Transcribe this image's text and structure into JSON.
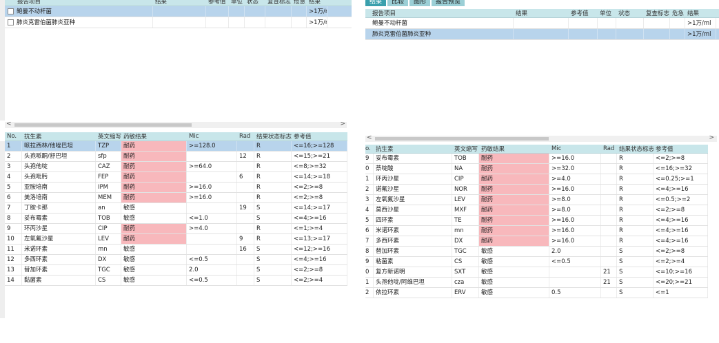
{
  "left": {
    "top_header": [
      "报告项目",
      "结果",
      "参考值",
      "单位",
      "状态",
      "复查标志",
      "危急",
      "结果"
    ],
    "top_rows": [
      {
        "name": "鲍曼不动杆菌",
        "result": ">1万/ml",
        "selected": true
      },
      {
        "name": "肺炎克雷伯菌肺炎亚种",
        "result": ">1万/ml",
        "selected": false
      }
    ],
    "scroll_left": "<",
    "scroll_right": ">",
    "bottom_header": [
      "No.",
      "抗生素",
      "英文缩写",
      "药敏结果",
      "Mic",
      "Rad",
      "结果状态标志",
      "参考值"
    ],
    "bottom_rows": [
      {
        "no": "1",
        "name": "哌拉西林/他唑巴坦",
        "abbr": "TZP",
        "res": "耐药",
        "mic": ">=128.0",
        "rad": "",
        "flag": "R",
        "ref": "<=16;>=128",
        "red": true,
        "sel": true
      },
      {
        "no": "2",
        "name": "头孢哌酮/舒巴坦",
        "abbr": "sfp",
        "res": "耐药",
        "mic": "",
        "rad": "12",
        "flag": "R",
        "ref": "<=15;>=21",
        "red": true
      },
      {
        "no": "3",
        "name": "头孢他啶",
        "abbr": "CAZ",
        "res": "耐药",
        "mic": ">=64.0",
        "rad": "",
        "flag": "R",
        "ref": "<=8;>=32",
        "red": true
      },
      {
        "no": "4",
        "name": "头孢吡肟",
        "abbr": "FEP",
        "res": "耐药",
        "mic": "",
        "rad": "6",
        "flag": "R",
        "ref": "<=14;>=18",
        "red": true
      },
      {
        "no": "5",
        "name": "亚胺培南",
        "abbr": "IPM",
        "res": "耐药",
        "mic": ">=16.0",
        "rad": "",
        "flag": "R",
        "ref": "<=2;>=8",
        "red": true
      },
      {
        "no": "6",
        "name": "美洛培南",
        "abbr": "MEM",
        "res": "耐药",
        "mic": ">=16.0",
        "rad": "",
        "flag": "R",
        "ref": "<=2;>=8",
        "red": true
      },
      {
        "no": "7",
        "name": "丁胺卡那",
        "abbr": "an",
        "res": "敏感",
        "mic": "",
        "rad": "19",
        "flag": "S",
        "ref": "<=14;>=17",
        "red": false
      },
      {
        "no": "8",
        "name": "妥布霉素",
        "abbr": "TOB",
        "res": "敏感",
        "mic": "<=1.0",
        "rad": "",
        "flag": "S",
        "ref": "<=4;>=16",
        "red": false
      },
      {
        "no": "9",
        "name": "环丙沙星",
        "abbr": "CIP",
        "res": "耐药",
        "mic": ">=4.0",
        "rad": "",
        "flag": "R",
        "ref": "<=1;>=4",
        "red": true
      },
      {
        "no": "10",
        "name": "左氧氟沙星",
        "abbr": "LEV",
        "res": "耐药",
        "mic": "",
        "rad": "9",
        "flag": "R",
        "ref": "<=13;>=17",
        "red": true
      },
      {
        "no": "11",
        "name": "米诺环素",
        "abbr": "mn",
        "res": "敏感",
        "mic": "",
        "rad": "16",
        "flag": "S",
        "ref": "<=12;>=16",
        "red": false
      },
      {
        "no": "12",
        "name": "多西环素",
        "abbr": "DX",
        "res": "敏感",
        "mic": "<=0.5",
        "rad": "",
        "flag": "S",
        "ref": "<=4;>=16",
        "red": false
      },
      {
        "no": "13",
        "name": "替加环素",
        "abbr": "TGC",
        "res": "敏感",
        "mic": "2.0",
        "rad": "",
        "flag": "S",
        "ref": "<=2;>=8",
        "red": false
      },
      {
        "no": "14",
        "name": "黏菌素",
        "abbr": "CS",
        "res": "敏感",
        "mic": "<=0.5",
        "rad": "",
        "flag": "S",
        "ref": "<=2;>=4",
        "red": false
      }
    ]
  },
  "right": {
    "tabs": [
      "结果",
      "比较",
      "图形",
      "报告预览"
    ],
    "top_header": [
      "报告项目",
      "结果",
      "参考值",
      "单位",
      "状态",
      "复查标志",
      "危急",
      "结果"
    ],
    "top_rows": [
      {
        "name": "鲍曼不动杆菌",
        "result": ">1万/ml",
        "selected": false
      },
      {
        "name": "肺炎克雷伯菌肺炎亚种",
        "result": ">1万/ml",
        "selected": true
      }
    ],
    "scroll_left": "<",
    "scroll_right": ">",
    "bottom_header": [
      "o.",
      "抗生素",
      "英文缩写",
      "药敏结果",
      "Mic",
      "Rad",
      "结果状态标志",
      "参考值"
    ],
    "bottom_rows": [
      {
        "no": "9",
        "name": "妥布霉素",
        "abbr": "TOB",
        "res": "耐药",
        "mic": ">=16.0",
        "rad": "",
        "flag": "R",
        "ref": "<=2;>=8",
        "red": true
      },
      {
        "no": "0",
        "name": "萘啶酸",
        "abbr": "NA",
        "res": "耐药",
        "mic": ">=32.0",
        "rad": "",
        "flag": "R",
        "ref": "<=16;>=32",
        "red": true
      },
      {
        "no": "1",
        "name": "环丙沙星",
        "abbr": "CIP",
        "res": "耐药",
        "mic": ">=4.0",
        "rad": "",
        "flag": "R",
        "ref": "<=0.25;>=1",
        "red": true
      },
      {
        "no": "2",
        "name": "诺氟沙星",
        "abbr": "NOR",
        "res": "耐药",
        "mic": ">=16.0",
        "rad": "",
        "flag": "R",
        "ref": "<=4;>=16",
        "red": true
      },
      {
        "no": "3",
        "name": "左氧氟沙星",
        "abbr": "LEV",
        "res": "耐药",
        "mic": ">=8.0",
        "rad": "",
        "flag": "R",
        "ref": "<=0.5;>=2",
        "red": true
      },
      {
        "no": "4",
        "name": "莫西沙星",
        "abbr": "MXF",
        "res": "耐药",
        "mic": ">=8.0",
        "rad": "",
        "flag": "R",
        "ref": "<=2;>=8",
        "red": true
      },
      {
        "no": "5",
        "name": "四环素",
        "abbr": "TE",
        "res": "耐药",
        "mic": ">=16.0",
        "rad": "",
        "flag": "R",
        "ref": "<=4;>=16",
        "red": true
      },
      {
        "no": "6",
        "name": "米诺环素",
        "abbr": "mn",
        "res": "耐药",
        "mic": ">=16.0",
        "rad": "",
        "flag": "R",
        "ref": "<=4;>=16",
        "red": true
      },
      {
        "no": "7",
        "name": "多西环素",
        "abbr": "DX",
        "res": "耐药",
        "mic": ">=16.0",
        "rad": "",
        "flag": "R",
        "ref": "<=4;>=16",
        "red": true
      },
      {
        "no": "8",
        "name": "替加环素",
        "abbr": "TGC",
        "res": "敏感",
        "mic": "2.0",
        "rad": "",
        "flag": "S",
        "ref": "<=2;>=8",
        "red": false
      },
      {
        "no": "9",
        "name": "粘菌素",
        "abbr": "CS",
        "res": "敏感",
        "mic": "<=0.5",
        "rad": "",
        "flag": "S",
        "ref": "<=2;>=4",
        "red": false
      },
      {
        "no": "0",
        "name": "复方新诺明",
        "abbr": "SXT",
        "res": "敏感",
        "mic": "",
        "rad": "21",
        "flag": "S",
        "ref": "<=10;>=16",
        "red": false
      },
      {
        "no": "1",
        "name": "头孢他啶/阿维巴坦",
        "abbr": "cza",
        "res": "敏感",
        "mic": "",
        "rad": "21",
        "flag": "S",
        "ref": "<=20;>=21",
        "red": false
      },
      {
        "no": "2",
        "name": "依拉环素",
        "abbr": "ERV",
        "res": "敏感",
        "mic": "0.5",
        "rad": "",
        "flag": "S",
        "ref": "<=1",
        "red": false
      }
    ]
  }
}
